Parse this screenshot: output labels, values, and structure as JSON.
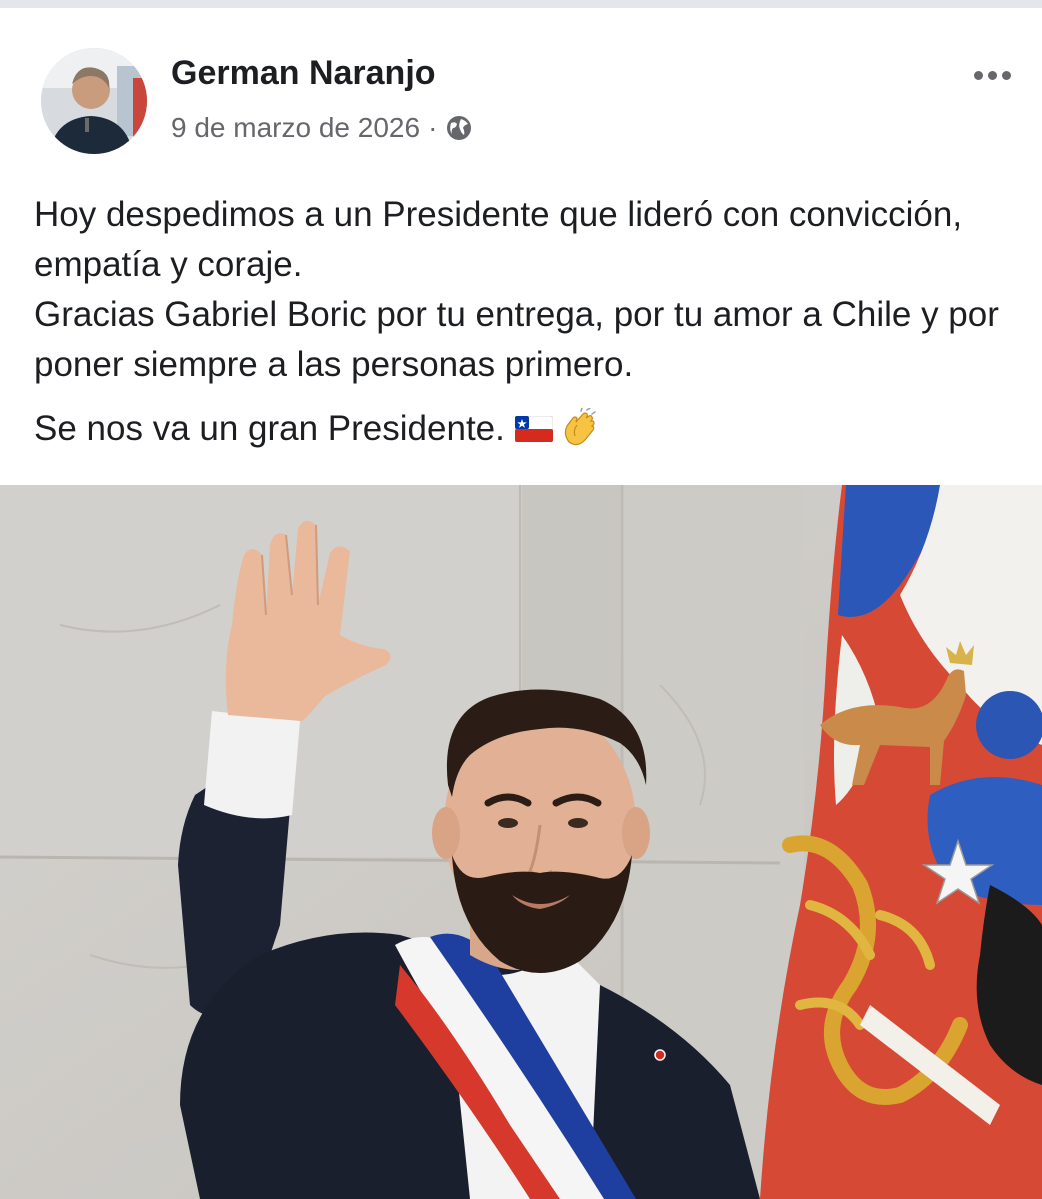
{
  "post": {
    "author": "German Naranjo",
    "date": "9 de marzo de 2026",
    "separator": "·",
    "privacy_icon": "globe-icon",
    "more_icon": "more-options-icon",
    "text_lines": [
      "Hoy despedimos a un Presidente que lideró con convicción, empatía y coraje.",
      "Gracias Gabriel Boric por tu entrega, por tu amor a Chile y por poner siempre a las personas primero."
    ],
    "closing_line": "Se nos va un gran Presidente.",
    "closing_emojis": [
      "chile-flag-emoji",
      "clapping-hands-emoji"
    ]
  },
  "colors": {
    "text": "#1c1e21",
    "meta": "#65676b",
    "chile_red": "#d52b1e",
    "chile_blue": "#0039a6"
  }
}
